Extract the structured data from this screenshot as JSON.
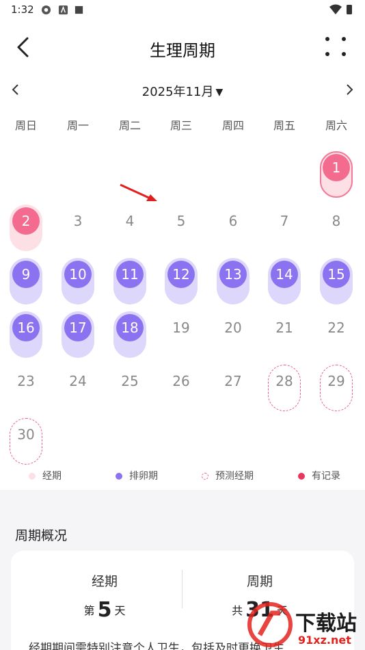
{
  "status_bar": {
    "time": "1:32"
  },
  "header": {
    "title": "生理周期"
  },
  "month": {
    "label": "2025年11月",
    "caret": "▼"
  },
  "weekdays": [
    "周日",
    "周一",
    "周二",
    "周三",
    "周四",
    "周五",
    "周六"
  ],
  "calendar": {
    "days": [
      {
        "n": "1",
        "type": "period-selected"
      },
      {
        "n": "2",
        "type": "period"
      },
      {
        "n": "3",
        "type": "normal"
      },
      {
        "n": "4",
        "type": "normal"
      },
      {
        "n": "5",
        "type": "normal"
      },
      {
        "n": "6",
        "type": "normal"
      },
      {
        "n": "7",
        "type": "normal"
      },
      {
        "n": "8",
        "type": "normal"
      },
      {
        "n": "9",
        "type": "ovulation"
      },
      {
        "n": "10",
        "type": "ovulation"
      },
      {
        "n": "11",
        "type": "ovulation"
      },
      {
        "n": "12",
        "type": "ovulation"
      },
      {
        "n": "13",
        "type": "ovulation"
      },
      {
        "n": "14",
        "type": "ovulation"
      },
      {
        "n": "15",
        "type": "ovulation"
      },
      {
        "n": "16",
        "type": "ovulation"
      },
      {
        "n": "17",
        "type": "ovulation"
      },
      {
        "n": "18",
        "type": "ovulation"
      },
      {
        "n": "19",
        "type": "normal"
      },
      {
        "n": "20",
        "type": "normal"
      },
      {
        "n": "21",
        "type": "normal"
      },
      {
        "n": "22",
        "type": "normal"
      },
      {
        "n": "23",
        "type": "normal"
      },
      {
        "n": "24",
        "type": "normal"
      },
      {
        "n": "25",
        "type": "normal"
      },
      {
        "n": "26",
        "type": "normal"
      },
      {
        "n": "27",
        "type": "normal"
      },
      {
        "n": "28",
        "type": "predicted"
      },
      {
        "n": "29",
        "type": "predicted"
      },
      {
        "n": "30",
        "type": "predicted"
      }
    ]
  },
  "legend": {
    "period": "经期",
    "ovulation": "排卵期",
    "predicted": "预测经期",
    "recorded": "有记录"
  },
  "colors": {
    "period": "#f36b8e",
    "ovulation": "#8b72f0",
    "recorded": "#e8365f",
    "period_light": "#fde0e6"
  },
  "overview": {
    "title": "周期概况",
    "period_label": "经期",
    "period_prefix": "第",
    "period_value": "5",
    "period_suffix": "天",
    "cycle_label": "周期",
    "cycle_prefix": "共",
    "cycle_value": "31",
    "cycle_suffix": "天",
    "tip": "经期期间需特别注意个人卫生，包括及时更换卫生"
  },
  "watermark": {
    "text": "下载站",
    "site": "91xz.net"
  }
}
